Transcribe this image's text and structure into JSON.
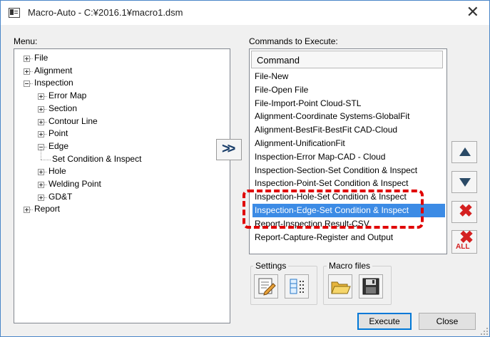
{
  "window": {
    "title": "Macro-Auto - C:¥2016.1¥macro1.dsm"
  },
  "menu": {
    "label": "Menu:",
    "tree": [
      {
        "label": "File",
        "level": 0,
        "expander": "plus"
      },
      {
        "label": "Alignment",
        "level": 0,
        "expander": "plus"
      },
      {
        "label": "Inspection",
        "level": 0,
        "expander": "minus"
      },
      {
        "label": "Error Map",
        "level": 1,
        "expander": "plus"
      },
      {
        "label": "Section",
        "level": 1,
        "expander": "plus"
      },
      {
        "label": "Contour Line",
        "level": 1,
        "expander": "plus"
      },
      {
        "label": "Point",
        "level": 1,
        "expander": "plus"
      },
      {
        "label": "Edge",
        "level": 1,
        "expander": "minus"
      },
      {
        "label": "Set Condition & Inspect",
        "level": 2,
        "expander": "none"
      },
      {
        "label": "Hole",
        "level": 1,
        "expander": "plus"
      },
      {
        "label": "Welding Point",
        "level": 1,
        "expander": "plus"
      },
      {
        "label": "GD&T",
        "level": 1,
        "expander": "plus"
      },
      {
        "label": "Report",
        "level": 0,
        "expander": "plus"
      }
    ]
  },
  "commands": {
    "label": "Commands to Execute:",
    "column_header": "Command",
    "selected_index": 10,
    "items": [
      "File-New",
      "File-Open File",
      "File-Import-Point Cloud-STL",
      "Alignment-Coordinate Systems-GlobalFit",
      "Alignment-BestFit-BestFit CAD-Cloud",
      "Alignment-UnificationFit",
      "Inspection-Error Map-CAD - Cloud",
      "Inspection-Section-Set Condition & Inspect",
      "Inspection-Point-Set Condition & Inspect",
      "Inspection-Hole-Set Condition & Inspect",
      "Inspection-Edge-Set Condition & Inspect",
      "Report-Inspection Result-CSV",
      "Report-Capture-Register and Output"
    ]
  },
  "side_buttons": {
    "all_label": "ALL"
  },
  "settings_group": {
    "label": "Settings"
  },
  "macro_group": {
    "label": "Macro files"
  },
  "buttons": {
    "execute": "Execute",
    "close": "Close"
  },
  "colors": {
    "selection": "#3c8be5",
    "highlight_box": "#e00000",
    "delete_red": "#d42020",
    "arrow_green": "#1f6f2e"
  }
}
